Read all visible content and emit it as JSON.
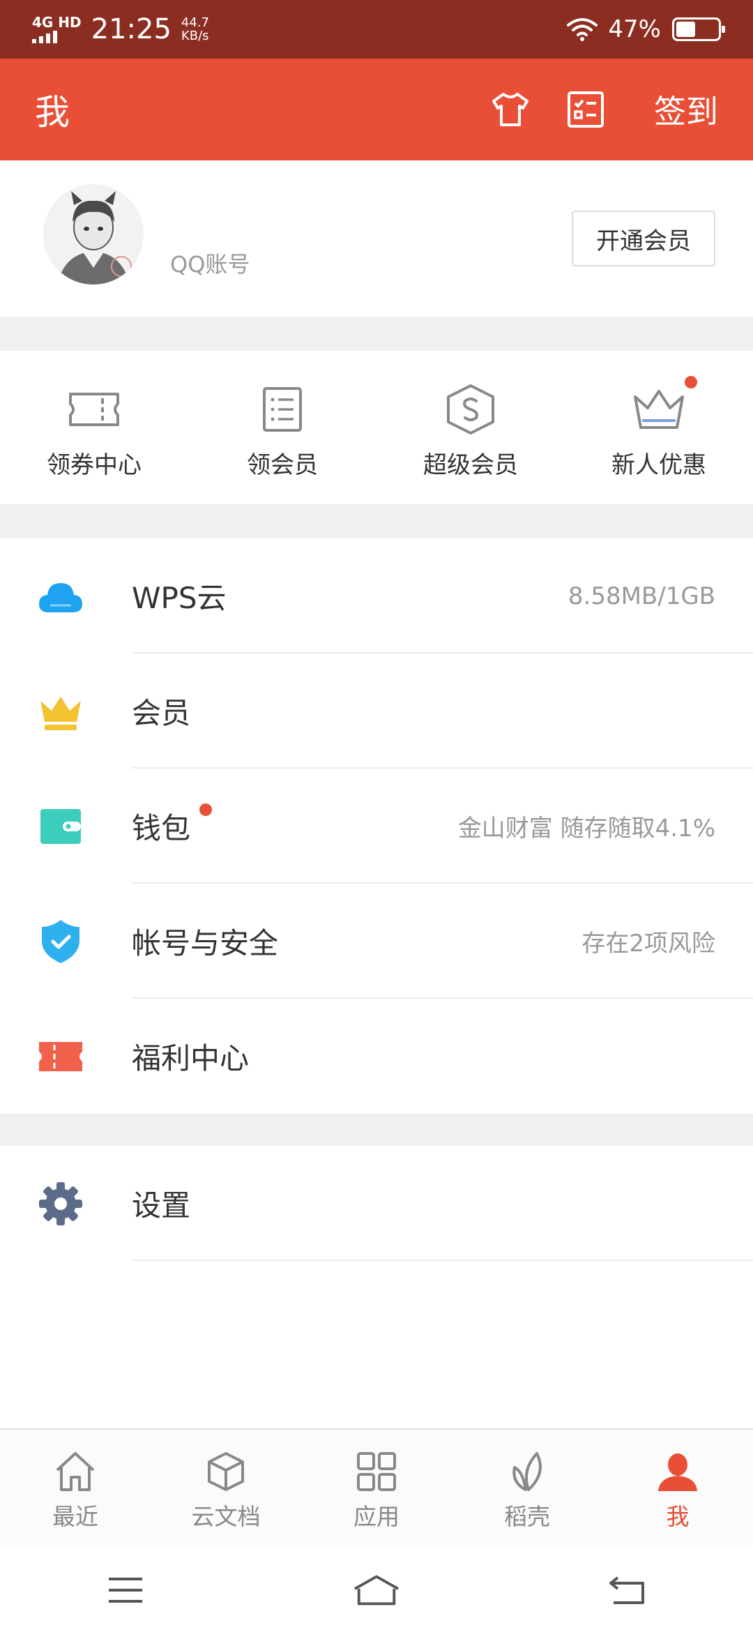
{
  "status_bar": {
    "network": "4G HD",
    "time": "21:25",
    "speed_value": "44.7",
    "speed_unit": "KB/s",
    "battery_percent": "47%",
    "battery_level": 0.47
  },
  "header": {
    "title": "我",
    "checkin_label": "签到",
    "icons": [
      "tshirt-icon",
      "checklist-icon"
    ]
  },
  "profile": {
    "account_label": "QQ账号",
    "vip_button": "开通会员"
  },
  "quick_actions": [
    {
      "label": "领券中心",
      "icon": "ticket-icon"
    },
    {
      "label": "领会员",
      "icon": "list-icon"
    },
    {
      "label": "超级会员",
      "icon": "super-member-icon"
    },
    {
      "label": "新人优惠",
      "icon": "crown-outline-icon",
      "badge": true
    }
  ],
  "menu": [
    {
      "label": "WPS云",
      "value": "8.58MB/1GB",
      "icon": "cloud-icon"
    },
    {
      "label": "会员",
      "value": "",
      "icon": "crown-icon"
    },
    {
      "label": "钱包",
      "value": "金山财富  随存随取4.1%",
      "icon": "wallet-icon",
      "badge": true
    },
    {
      "label": "帐号与安全",
      "value": "存在2项风险",
      "icon": "shield-icon"
    },
    {
      "label": "福利中心",
      "value": "",
      "icon": "coupon-icon"
    }
  ],
  "settings": {
    "label": "设置",
    "icon": "gear-icon"
  },
  "tabs": [
    {
      "label": "最近",
      "icon": "home-icon",
      "active": false
    },
    {
      "label": "云文档",
      "icon": "cube-icon",
      "active": false
    },
    {
      "label": "应用",
      "icon": "grid-icon",
      "active": false
    },
    {
      "label": "稻壳",
      "icon": "leaf-icon",
      "active": false
    },
    {
      "label": "我",
      "icon": "person-icon",
      "active": true
    }
  ],
  "colors": {
    "brand": "#e84f36",
    "status_bar": "#8b2e21",
    "cloud": "#1fa2f0",
    "crown": "#f2c432",
    "wallet": "#3dcdbd",
    "shield": "#2fb0ee",
    "coupon": "#f0624b",
    "gear": "#5d6b8a"
  }
}
